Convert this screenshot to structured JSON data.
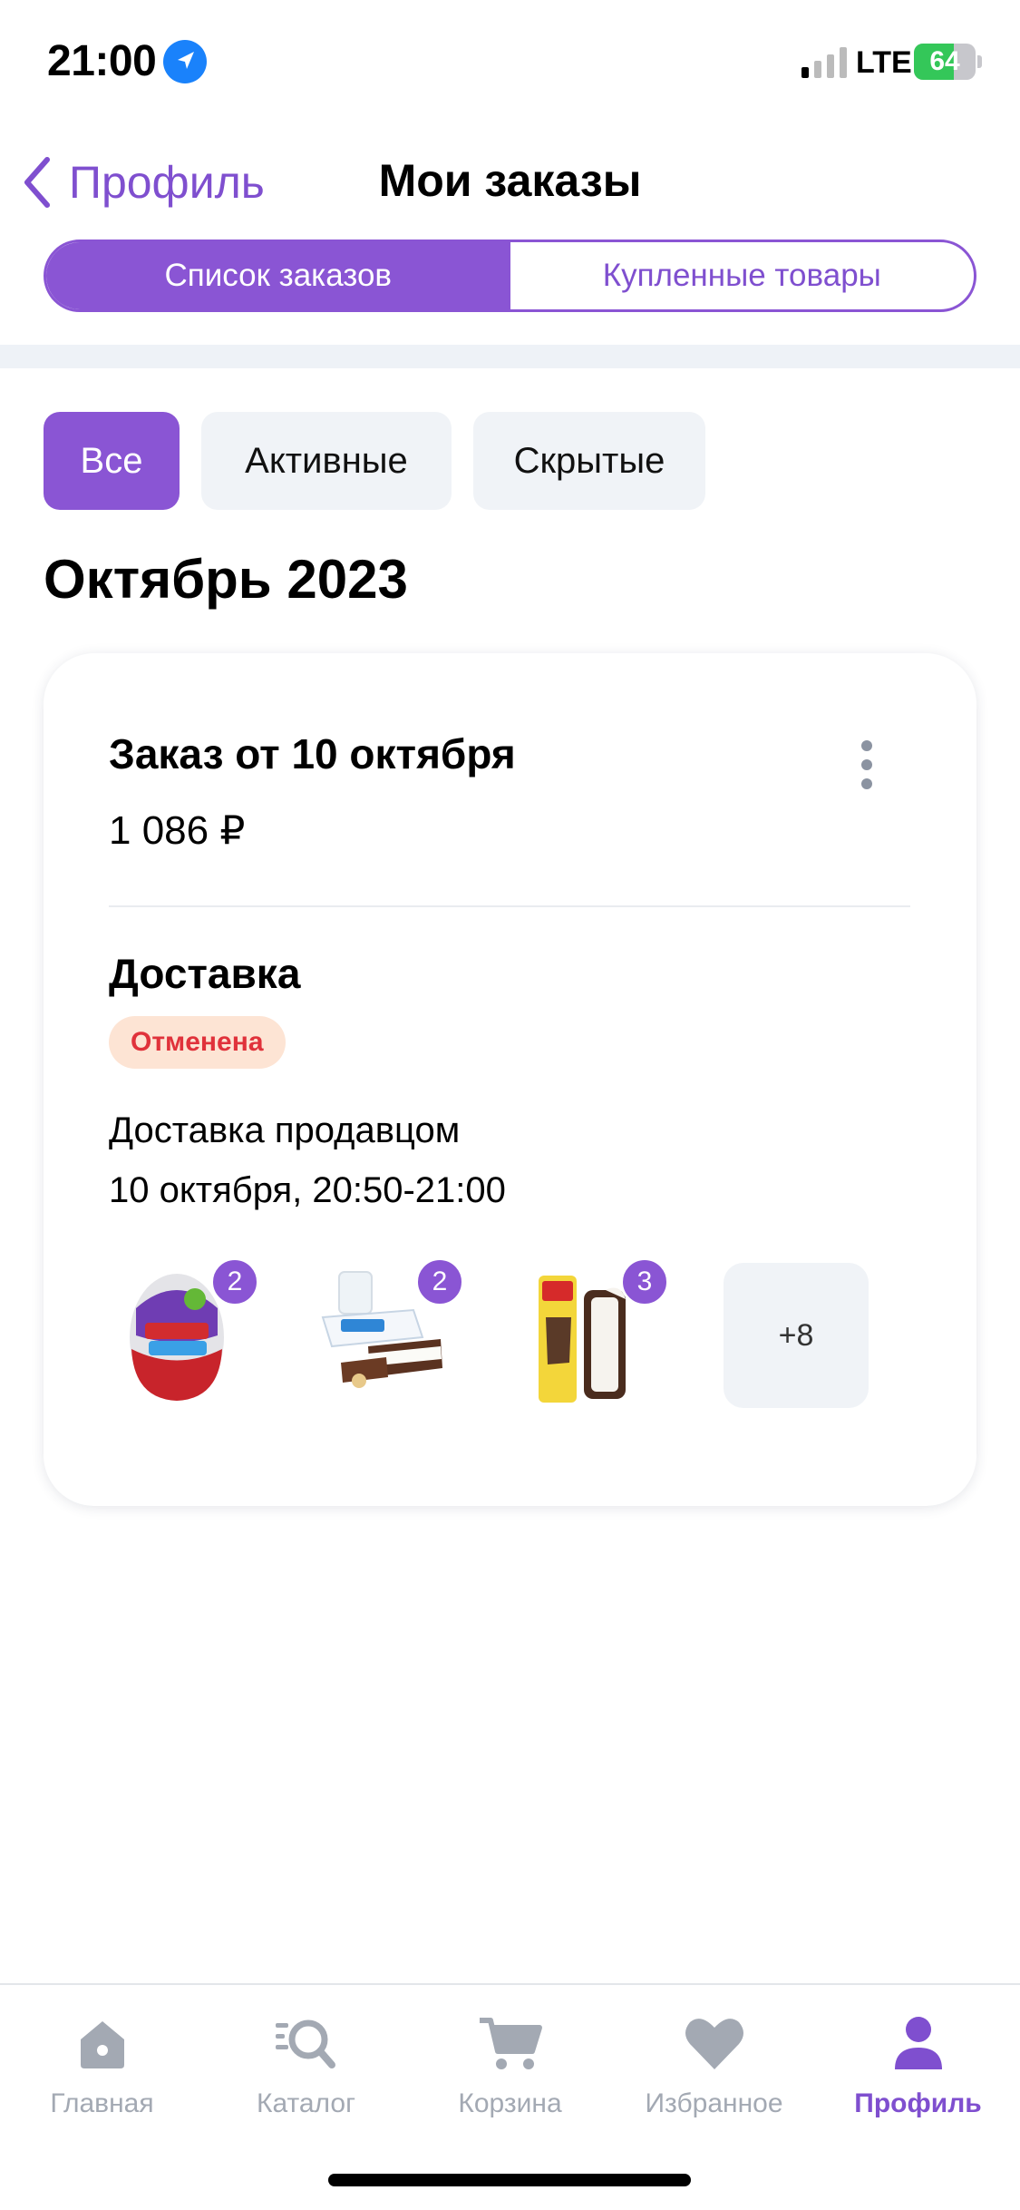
{
  "status_bar": {
    "time": "21:00",
    "network": "LTE",
    "battery": "64",
    "battery_level": 0.64
  },
  "nav": {
    "back_label": "Профиль",
    "title": "Мои заказы"
  },
  "segments": [
    {
      "label": "Список заказов",
      "active": true
    },
    {
      "label": "Купленные товары",
      "active": false
    }
  ],
  "filters": [
    {
      "label": "Все",
      "active": true
    },
    {
      "label": "Активные",
      "active": false
    },
    {
      "label": "Скрытые",
      "active": false
    }
  ],
  "month": "Октябрь 2023",
  "order": {
    "title": "Заказ от 10 октября",
    "price": "1 086 ₽",
    "delivery_title": "Доставка",
    "status": "Отменена",
    "delivery_by": "Доставка продавцом",
    "delivery_time": "10 октября, 20:50-21:00",
    "items": [
      {
        "icon": "kinder-surprise-egg-icon",
        "qty": "2"
      },
      {
        "icon": "milk-slice-icon",
        "qty": "2"
      },
      {
        "icon": "ice-cream-sandwich-icon",
        "qty": "3"
      }
    ],
    "more": "+8"
  },
  "tabs": [
    {
      "label": "Главная",
      "icon": "home-icon",
      "active": false
    },
    {
      "label": "Каталог",
      "icon": "catalog-search-icon",
      "active": false
    },
    {
      "label": "Корзина",
      "icon": "cart-icon",
      "active": false
    },
    {
      "label": "Избранное",
      "icon": "heart-icon",
      "active": false
    },
    {
      "label": "Профиль",
      "icon": "profile-icon",
      "active": true
    }
  ],
  "colors": {
    "accent": "#8a55d4",
    "badge_bg": "#fde4d4",
    "badge_text": "#e0323b",
    "chip_bg": "#f0f3f7"
  }
}
